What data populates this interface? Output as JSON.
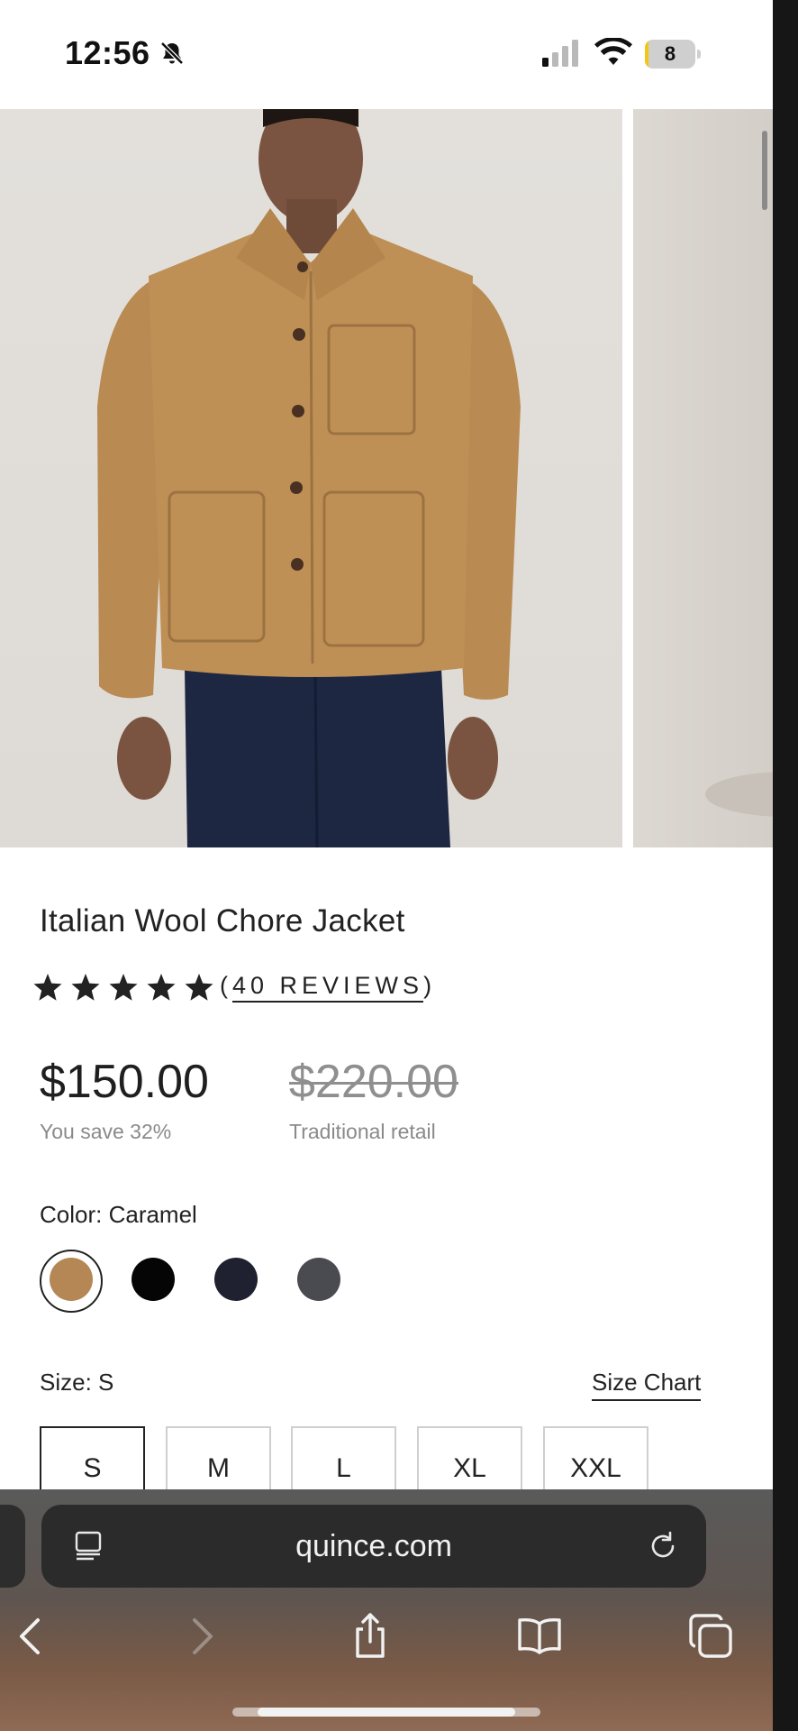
{
  "status_bar": {
    "time": "12:56",
    "battery_level": "8",
    "silent_icon": "bell-slash-icon",
    "signal_icon": "cellular-signal-icon",
    "wifi_icon": "wifi-icon"
  },
  "gallery": {
    "main_image": "caramel-chore-jacket-photo",
    "next_image": "next-product-photo"
  },
  "product": {
    "title": "Italian Wool Chore Jacket",
    "rating_stars": 5,
    "reviews_label": "40 REVIEWS",
    "reviews_open": "(",
    "reviews_close": ")",
    "price": "$150.00",
    "savings": "You save 32%",
    "original_price": "$220.00",
    "original_label": "Traditional retail",
    "color_label": "Color: Caramel",
    "colors": [
      {
        "name": "Caramel",
        "hex": "#b58754",
        "selected": true
      },
      {
        "name": "Black",
        "hex": "#050505",
        "selected": false
      },
      {
        "name": "Navy",
        "hex": "#1f2030",
        "selected": false
      },
      {
        "name": "Charcoal",
        "hex": "#4a4b50",
        "selected": false
      }
    ],
    "size_label": "Size: S",
    "size_chart": "Size Chart",
    "sizes": [
      {
        "label": "S",
        "selected": true
      },
      {
        "label": "M",
        "selected": false
      },
      {
        "label": "L",
        "selected": false
      },
      {
        "label": "XL",
        "selected": false
      },
      {
        "label": "XXL",
        "selected": false
      }
    ]
  },
  "browser": {
    "url": "quince.com",
    "reader_icon": "reader-mode-icon",
    "reload_icon": "reload-icon",
    "toolbar": [
      "back-icon",
      "forward-icon",
      "share-icon",
      "bookmarks-icon",
      "tabs-icon"
    ]
  },
  "colors": {
    "page_bg": "#ffffff",
    "text": "#222222",
    "muted": "#8a8a8a",
    "battery": "#f3c515",
    "address_bar": "#2b2b2b"
  }
}
